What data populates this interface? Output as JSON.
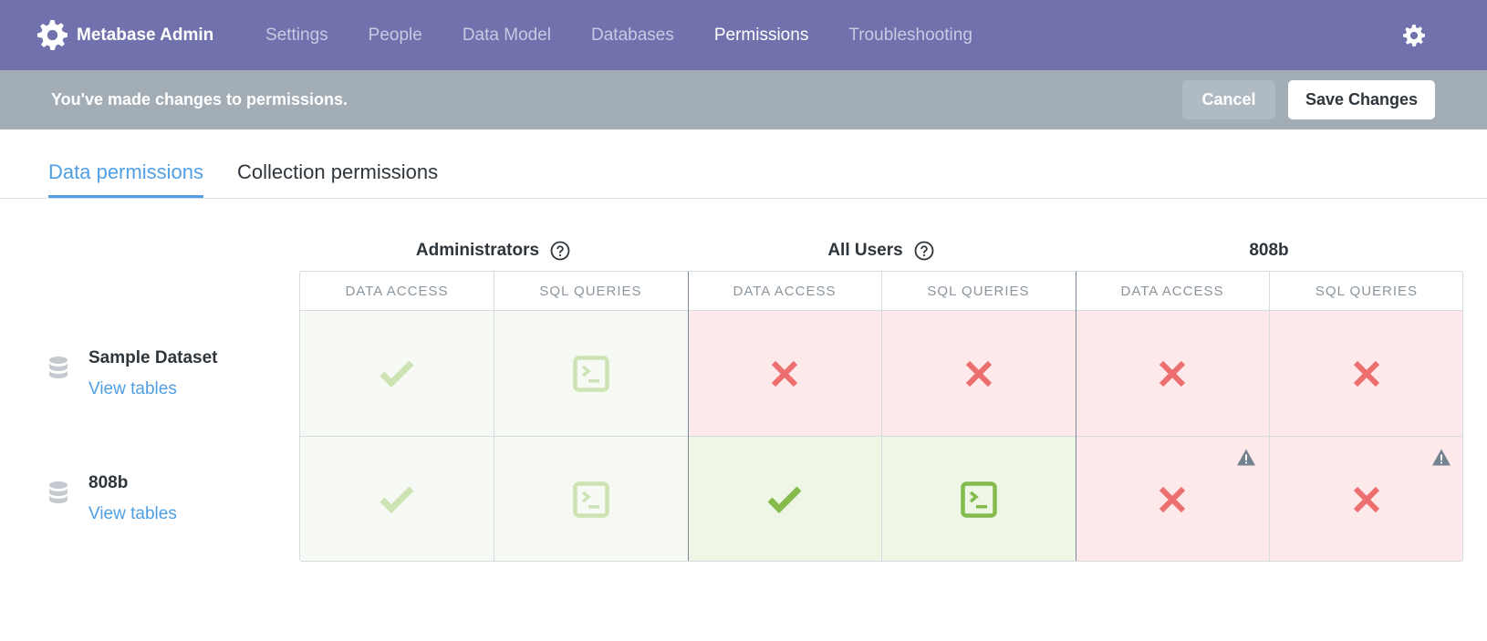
{
  "app": {
    "brand": "Metabase Admin",
    "nav": [
      "Settings",
      "People",
      "Data Model",
      "Databases",
      "Permissions",
      "Troubleshooting"
    ],
    "active_nav": "Permissions"
  },
  "changes_bar": {
    "message": "You've made changes to permissions.",
    "cancel_label": "Cancel",
    "save_label": "Save Changes"
  },
  "tabs": {
    "data": "Data permissions",
    "collection": "Collection permissions"
  },
  "groups": [
    {
      "name": "Administrators",
      "has_help": true
    },
    {
      "name": "All Users",
      "has_help": true
    },
    {
      "name": "808b",
      "has_help": false
    }
  ],
  "columns": {
    "data_access": "DATA ACCESS",
    "sql_queries": "SQL QUERIES"
  },
  "databases": [
    {
      "name": "Sample Dataset",
      "link": "View tables",
      "cells": [
        "check-light",
        "sql-light",
        "x",
        "x",
        "x",
        "x"
      ],
      "warnings": [
        false,
        false,
        false,
        false,
        false,
        false
      ]
    },
    {
      "name": "808b",
      "link": "View tables",
      "cells": [
        "check-light",
        "sql-light",
        "check",
        "sql",
        "x",
        "x"
      ],
      "warnings": [
        false,
        false,
        false,
        false,
        true,
        true
      ]
    }
  ],
  "colors": {
    "nav_bg": "#7172ad",
    "changes_bar_bg": "#a2adb6",
    "accent_blue": "#509ee3",
    "green": "#84bb4c",
    "green_light": "#cde3b4",
    "red": "#ed6e6e",
    "red_bg": "#fde9ea",
    "green_bg": "#eef6e6",
    "green_light_bg": "#f7faf4"
  },
  "icons": {
    "brand": "gear-icon",
    "settings": "gear-icon",
    "help": "question-circle-icon",
    "database": "database-icon",
    "check": "check-icon",
    "sql": "terminal-icon",
    "x": "close-icon",
    "warning": "warning-icon"
  }
}
